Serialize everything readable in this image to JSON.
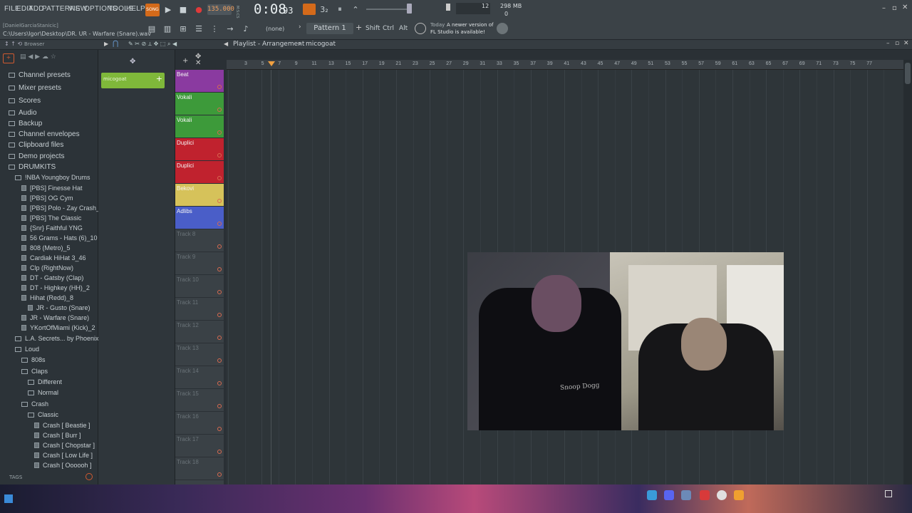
{
  "menu": [
    "FILE",
    "EDIT",
    "ADD",
    "PATTERNS",
    "VIEW",
    "OPTIONS",
    "TOOLS",
    "HELP"
  ],
  "transport": {
    "song_label": "SONG",
    "tempo": "135.000",
    "time": "0:08",
    "time_sub": "93",
    "time_unit": "M:S:CS",
    "pattern": "Pattern 1",
    "none_label": "(none)",
    "cpu": "12",
    "memory": "298 MB",
    "mem_sub": "0"
  },
  "modifiers": [
    "Shift",
    "Ctrl",
    "Alt"
  ],
  "news": {
    "line1": "Today",
    "line2": "A newer version of",
    "line3": "FL Studio is available!"
  },
  "project": {
    "user": "[DanielGarciaStanicic]",
    "path": "C:\\Users\\Igor\\Desktop\\DR. UR - Warfare (Snare).wav"
  },
  "browser": {
    "title": "Browser",
    "tags_label": "TAGS",
    "items": [
      {
        "label": "Channel presets",
        "indent": 0,
        "kind": "folder"
      },
      {
        "label": "Mixer presets",
        "indent": 0,
        "kind": "folder"
      },
      {
        "label": "Scores",
        "indent": 0,
        "kind": "folder"
      },
      {
        "label": "Audio",
        "indent": 0,
        "kind": "folder"
      },
      {
        "label": "Backup",
        "indent": 0,
        "kind": "folder"
      },
      {
        "label": "Channel envelopes",
        "indent": 0,
        "kind": "folder"
      },
      {
        "label": "Clipboard files",
        "indent": 0,
        "kind": "folder"
      },
      {
        "label": "Demo projects",
        "indent": 0,
        "kind": "folder"
      },
      {
        "label": "DRUMKITS",
        "indent": 0,
        "kind": "folder"
      },
      {
        "label": "!NBA Youngboy Drums",
        "indent": 1,
        "kind": "folder"
      },
      {
        "label": "[PBS] Finesse Hat",
        "indent": 2,
        "kind": "file"
      },
      {
        "label": "[PBS] OG Cym",
        "indent": 2,
        "kind": "file"
      },
      {
        "label": "[PBS] Polo - Zay Crash_3",
        "indent": 2,
        "kind": "file"
      },
      {
        "label": "[PBS] The Classic",
        "indent": 2,
        "kind": "file"
      },
      {
        "label": "{Snr} Faithful YNG",
        "indent": 2,
        "kind": "file"
      },
      {
        "label": "56 Grams - Hats (6)_10",
        "indent": 2,
        "kind": "file"
      },
      {
        "label": "808 (Metro)_5",
        "indent": 2,
        "kind": "file"
      },
      {
        "label": "Cardiak HiHat 3_46",
        "indent": 2,
        "kind": "file"
      },
      {
        "label": "Clp (RightNow)",
        "indent": 2,
        "kind": "file"
      },
      {
        "label": "DT - Gatsby (Clap)",
        "indent": 2,
        "kind": "file"
      },
      {
        "label": "DT - Highkey (HH)_2",
        "indent": 2,
        "kind": "file"
      },
      {
        "label": "Hihat (Redd)_8",
        "indent": 2,
        "kind": "file"
      },
      {
        "label": "JR - Gusto (Snare)",
        "indent": 3,
        "kind": "file"
      },
      {
        "label": "JR - Warfare (Snare)",
        "indent": 2,
        "kind": "file"
      },
      {
        "label": "YKortOfMiami (Kick)_2",
        "indent": 2,
        "kind": "file"
      },
      {
        "label": "L.A. Secrets... by Phoenix)",
        "indent": 1,
        "kind": "folder"
      },
      {
        "label": "Loud",
        "indent": 1,
        "kind": "folder"
      },
      {
        "label": "808s",
        "indent": 2,
        "kind": "folder"
      },
      {
        "label": "Claps",
        "indent": 2,
        "kind": "folder"
      },
      {
        "label": "Different",
        "indent": 3,
        "kind": "folder"
      },
      {
        "label": "Normal",
        "indent": 3,
        "kind": "folder"
      },
      {
        "label": "Crash",
        "indent": 2,
        "kind": "folder"
      },
      {
        "label": "Classic",
        "indent": 3,
        "kind": "folder"
      },
      {
        "label": "Crash [ Beastie ]",
        "indent": 4,
        "kind": "file"
      },
      {
        "label": "Crash [ Burr ]",
        "indent": 4,
        "kind": "file"
      },
      {
        "label": "Crash [ Chopstar ]",
        "indent": 4,
        "kind": "file"
      },
      {
        "label": "Crash [ Low Life ]",
        "indent": 4,
        "kind": "file"
      },
      {
        "label": "Crash [ Oooooh ]",
        "indent": 4,
        "kind": "file"
      }
    ]
  },
  "playlist": {
    "title": "Playlist - Arrangement",
    "pattern_name": "micogoat",
    "clip_label": "micogoat",
    "ruler": [
      "3",
      "5",
      "7",
      "9",
      "11",
      "13",
      "15",
      "17",
      "19",
      "21",
      "23",
      "25",
      "27",
      "29",
      "31",
      "33",
      "35",
      "37",
      "39",
      "41",
      "43",
      "45",
      "47",
      "49",
      "51",
      "53",
      "55",
      "57",
      "59",
      "61",
      "63",
      "65",
      "67",
      "69",
      "71",
      "73",
      "75",
      "77"
    ],
    "tracks": [
      {
        "label": "Beat",
        "color": "#8a3aa0"
      },
      {
        "label": "Vokali",
        "color": "#3d9a3a"
      },
      {
        "label": "Vokali",
        "color": "#3d9a3a"
      },
      {
        "label": "Duplici",
        "color": "#c0222e"
      },
      {
        "label": "Duplici",
        "color": "#c0222e"
      },
      {
        "label": "Bekovi",
        "color": "#d6c25a"
      },
      {
        "label": "Adlibs",
        "color": "#4a5ec8"
      },
      {
        "label": "Track 8",
        "color": ""
      },
      {
        "label": "Track 9",
        "color": ""
      },
      {
        "label": "Track 10",
        "color": ""
      },
      {
        "label": "Track 11",
        "color": ""
      },
      {
        "label": "Track 12",
        "color": ""
      },
      {
        "label": "Track 13",
        "color": ""
      },
      {
        "label": "Track 14",
        "color": ""
      },
      {
        "label": "Track 15",
        "color": ""
      },
      {
        "label": "Track 16",
        "color": ""
      },
      {
        "label": "Track 17",
        "color": ""
      },
      {
        "label": "Track 18",
        "color": ""
      }
    ]
  },
  "webcam": {
    "shirt_text": "Snoop Dogg"
  }
}
